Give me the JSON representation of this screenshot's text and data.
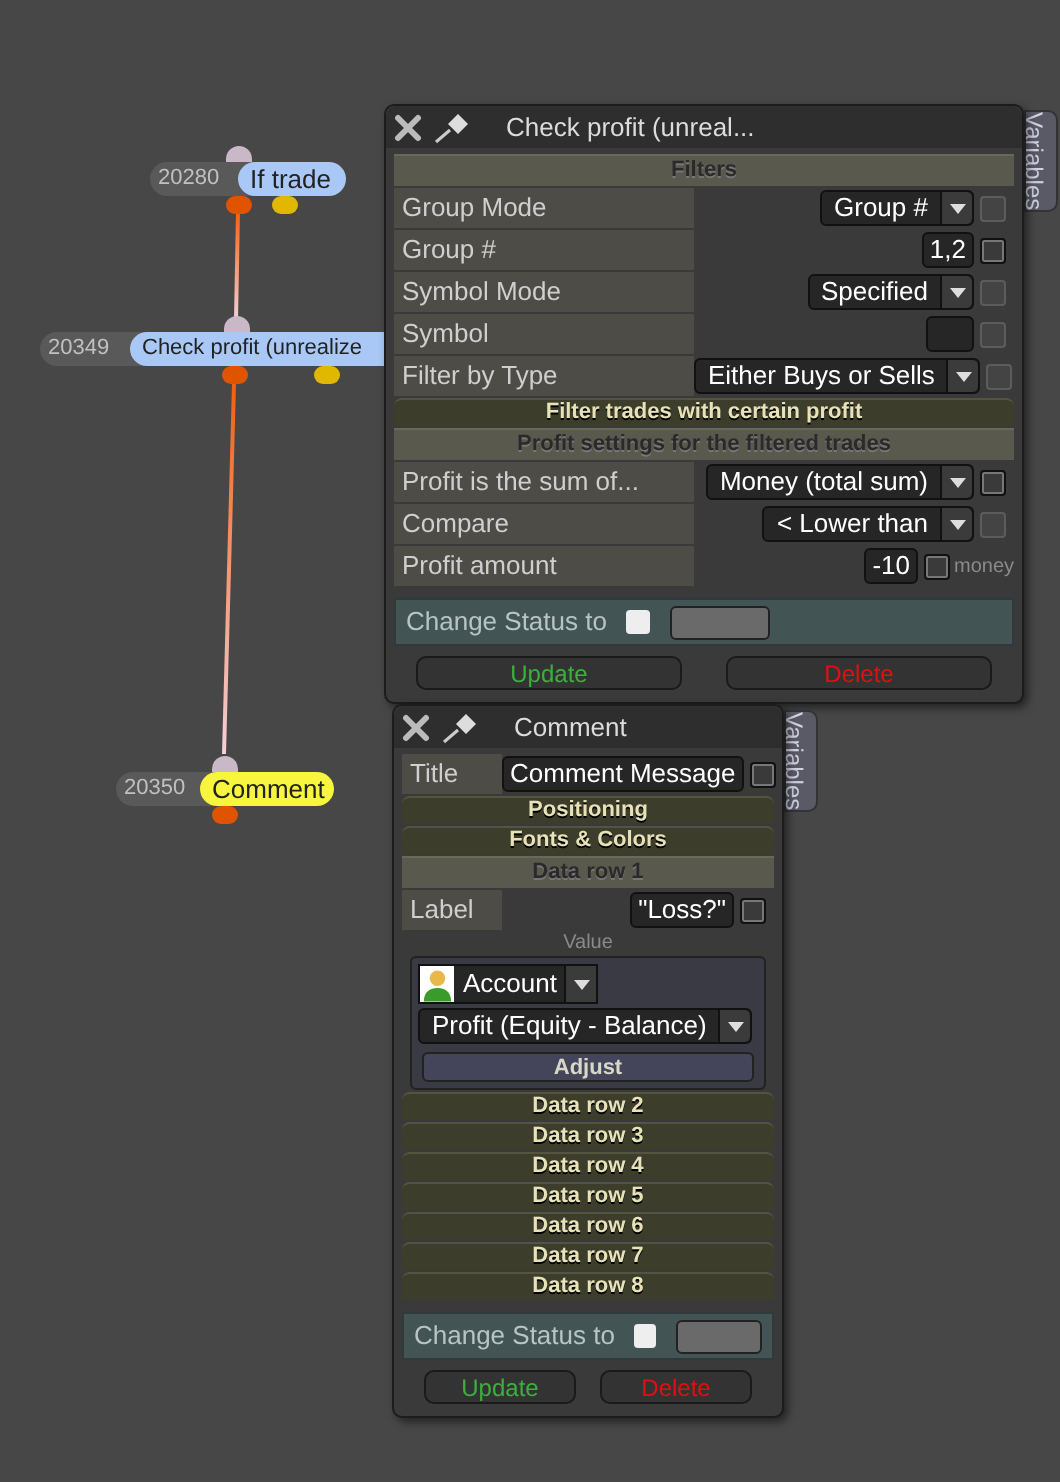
{
  "nodes": [
    {
      "id": "20280",
      "title": "If trade",
      "color": "#a9c8f5"
    },
    {
      "id": "20349",
      "title": "Check profit (unrealize",
      "color": "#a9c8f5"
    },
    {
      "id": "20350",
      "title": "Comment",
      "color": "#f7f53e"
    }
  ],
  "panels": [
    {
      "title": "Check profit (unreal...",
      "side_tab": "Variables",
      "rows": [
        {
          "kind": "subheader",
          "text": "Filters"
        },
        {
          "kind": "select",
          "label": "Group Mode",
          "value": "Group #",
          "checkbox_disabled": true
        },
        {
          "kind": "input",
          "label": "Group #",
          "value": "1,2",
          "checkbox_disabled": false
        },
        {
          "kind": "select",
          "label": "Symbol Mode",
          "value": "Specified",
          "checkbox_disabled": true
        },
        {
          "kind": "input",
          "label": "Symbol",
          "checkbox_disabled": true
        },
        {
          "kind": "select",
          "label": "Filter by Type",
          "value": "Either Buys or Sells",
          "checkbox_disabled": true
        },
        {
          "kind": "bar",
          "text": "Filter trades with certain profit"
        },
        {
          "kind": "subheader",
          "text": "Profit settings for the filtered trades"
        },
        {
          "kind": "select",
          "label": "Profit is the sum of...",
          "value": "Money (total sum)",
          "checkbox_disabled": false
        },
        {
          "kind": "select",
          "label": "Compare",
          "value": "< Lower than",
          "checkbox_disabled": true
        },
        {
          "kind": "input",
          "label": "Profit amount",
          "value": "-10",
          "checkbox_disabled": false,
          "unit": "money"
        }
      ],
      "status": {
        "label": "Change Status to",
        "checked": false
      },
      "buttons": [
        {
          "label": "Update",
          "kind": "update"
        },
        {
          "label": "Delete",
          "kind": "delete"
        }
      ]
    },
    {
      "title": "Comment",
      "side_tab": "Variables",
      "rows": [
        {
          "kind": "input",
          "label": "Title",
          "value": "Comment Message",
          "checkbox_disabled": false
        },
        {
          "kind": "bar",
          "text": "Positioning"
        },
        {
          "kind": "bar",
          "text": "Fonts & Colors"
        },
        {
          "kind": "subheader",
          "text": "Data row 1"
        },
        {
          "kind": "input",
          "label": "Label",
          "value": "\"Loss?\"",
          "checkbox_disabled": false
        },
        {
          "kind": "caption",
          "text": "Value"
        },
        {
          "kind": "value_group",
          "source": "Account",
          "value": "Profit (Equity - Balance)",
          "button": "Adjust"
        },
        {
          "kind": "bar",
          "text": "Data row 2"
        },
        {
          "kind": "bar",
          "text": "Data row 3"
        },
        {
          "kind": "bar",
          "text": "Data row 4"
        },
        {
          "kind": "bar",
          "text": "Data row 5"
        },
        {
          "kind": "bar",
          "text": "Data row 6"
        },
        {
          "kind": "bar",
          "text": "Data row 7"
        },
        {
          "kind": "bar",
          "text": "Data row 8"
        }
      ],
      "status": {
        "label": "Change Status to",
        "checked": false
      },
      "buttons": [
        {
          "label": "Update",
          "kind": "update"
        },
        {
          "label": "Delete",
          "kind": "delete"
        }
      ]
    }
  ]
}
